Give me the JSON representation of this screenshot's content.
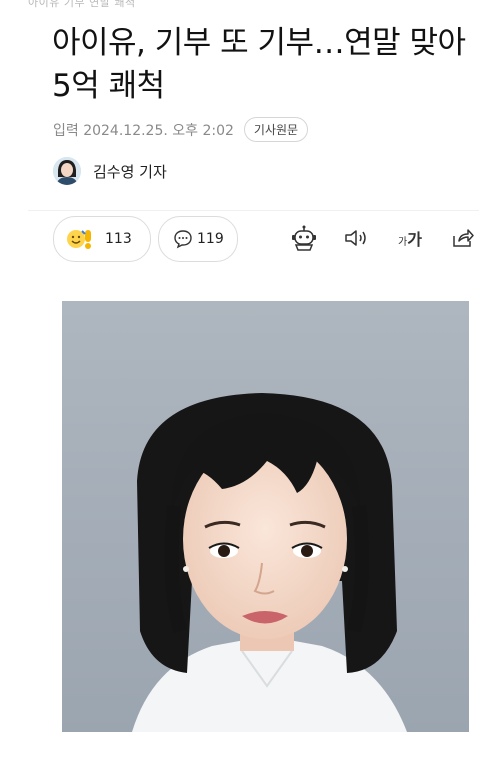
{
  "top_faded_text": "아이유 기부 연말 쾌척",
  "headline": "아이유, 기부 또 기부…연말 맞아 5억 쾌척",
  "meta": {
    "date": "입력 2024.12.25. 오후 2:02",
    "source_button": "기사원문"
  },
  "byline": {
    "reporter": "김수영 기자"
  },
  "actions": {
    "reaction_count": "113",
    "comment_count": "119",
    "font_size_label_small": "가",
    "font_size_label_large": "가"
  },
  "icons": [
    "reaction-emoji-icon",
    "comment-bubble-icon",
    "robot-summary-icon",
    "speaker-icon",
    "font-size-icon",
    "share-icon"
  ],
  "colors": {
    "headline": "#121212",
    "meta": "#8a8a8a",
    "photo_background": "#a8b1bb"
  }
}
